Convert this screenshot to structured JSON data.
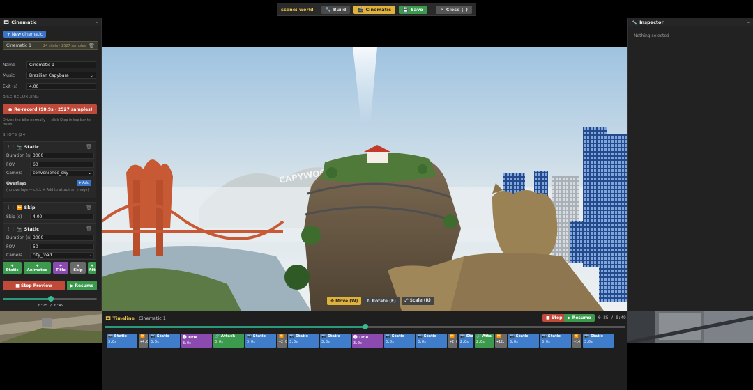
{
  "topbar": {
    "scene": "scene: world",
    "build": "Build",
    "cinematic": "Cinematic",
    "save": "Save",
    "close": "Close (`)"
  },
  "left": {
    "title": "Cinematic",
    "minimize": "–",
    "new_cinematic": "+ New cinematic",
    "cinematic_item": {
      "name": "Cinematic 1",
      "meta": "24 shots · 2527 samples"
    },
    "fields": {
      "name_label": "Name",
      "name_value": "Cinematic 1",
      "music_label": "Music",
      "music_value": "Brazilian Capybara",
      "exit_label": "Exit (s)",
      "exit_value": "4.00"
    },
    "bike_recording": "BIKE RECORDING",
    "rerecord": "Re-record (98.9s · 2527 samples)",
    "rerecord_hint": "Drives the bike normally — click Stop in top bar to finish.",
    "shots_header": "SHOTS (24)",
    "shot1": {
      "title": "Static",
      "duration_label": "Duration (ms)",
      "duration": "3000",
      "fov_label": "FOV",
      "fov": "60",
      "camera_label": "Camera",
      "camera": "convenience_sky",
      "overlays_label": "Overlays",
      "add_label": "+ Add",
      "overlays_hint": "(no overlays — click + Add to attach an image)"
    },
    "shot2": {
      "title": "Skip",
      "skip_label": "Skip (s)",
      "skip": "4.00"
    },
    "shot3": {
      "title": "Static",
      "duration_label": "Duration (ms)",
      "duration": "3000",
      "fov_label": "FOV",
      "fov": "50",
      "camera_label": "Camera",
      "camera": "city_road"
    },
    "add_buttons": [
      {
        "l1": "+",
        "l2": "Static"
      },
      {
        "l1": "+",
        "l2": "Animated"
      },
      {
        "l1": "+",
        "l2": "Title"
      },
      {
        "l1": "+",
        "l2": "Skip"
      },
      {
        "l1": "+",
        "l2": "Att"
      }
    ],
    "stop_preview": "■ Stop Preview",
    "resume": "▶ Resume",
    "progress": 0.51,
    "time": "0:25 / 0:49"
  },
  "right": {
    "title": "Inspector",
    "minimize": "–",
    "empty": "Nothing selected"
  },
  "viewport": {
    "sign_text": "CAPYWOOD"
  },
  "gizmo": {
    "move": "✥ Move (W)",
    "rotate": "↻ Rotate (E)",
    "scale": "⤢ Scale (R)"
  },
  "timeline": {
    "title": "Timeline",
    "name": "Cinematic 1",
    "stop": "■ Stop",
    "resume": "▶ Resume",
    "time": "0:25 / 0:49",
    "progress": 0.5,
    "clips": [
      {
        "type": "static",
        "title": "📷 Static",
        "dur": "3.0s"
      },
      {
        "type": "skip",
        "title": "⏩",
        "dur": "+4.0"
      },
      {
        "type": "static",
        "title": "📷 Static",
        "dur": "3.0s"
      },
      {
        "type": "title",
        "title": "🅣 Title",
        "dur": "3.0s"
      },
      {
        "type": "attach",
        "title": "🔗 Attach",
        "dur": "3.0s"
      },
      {
        "type": "static",
        "title": "📷 Static",
        "dur": "3.0s"
      },
      {
        "type": "skip",
        "title": "⏩",
        "dur": "+2.0"
      },
      {
        "type": "static",
        "title": "📷 Static",
        "dur": "3.0s"
      },
      {
        "type": "static",
        "title": "📷 Static",
        "dur": "3.0s"
      },
      {
        "type": "title",
        "title": "🅣 Title",
        "dur": "3.0s"
      },
      {
        "type": "static",
        "title": "📷 Static",
        "dur": "3.0s"
      },
      {
        "type": "static",
        "title": "📷 Static",
        "dur": "3.0s"
      },
      {
        "type": "skip",
        "title": "⏩",
        "dur": "+2.0"
      },
      {
        "type": "static",
        "title": "📷 Sta",
        "dur": "2.0s"
      },
      {
        "type": "attach",
        "title": "🔗 Atta",
        "dur": "2.0s"
      },
      {
        "type": "skip",
        "title": "⏩",
        "dur": "+12."
      },
      {
        "type": "static",
        "title": "📷 Static",
        "dur": "3.0s"
      },
      {
        "type": "static",
        "title": "📷 Static",
        "dur": "3.0s"
      },
      {
        "type": "skip",
        "title": "⏩",
        "dur": "+14"
      },
      {
        "type": "static",
        "title": "📷 Static",
        "dur": "3.0s"
      }
    ]
  }
}
